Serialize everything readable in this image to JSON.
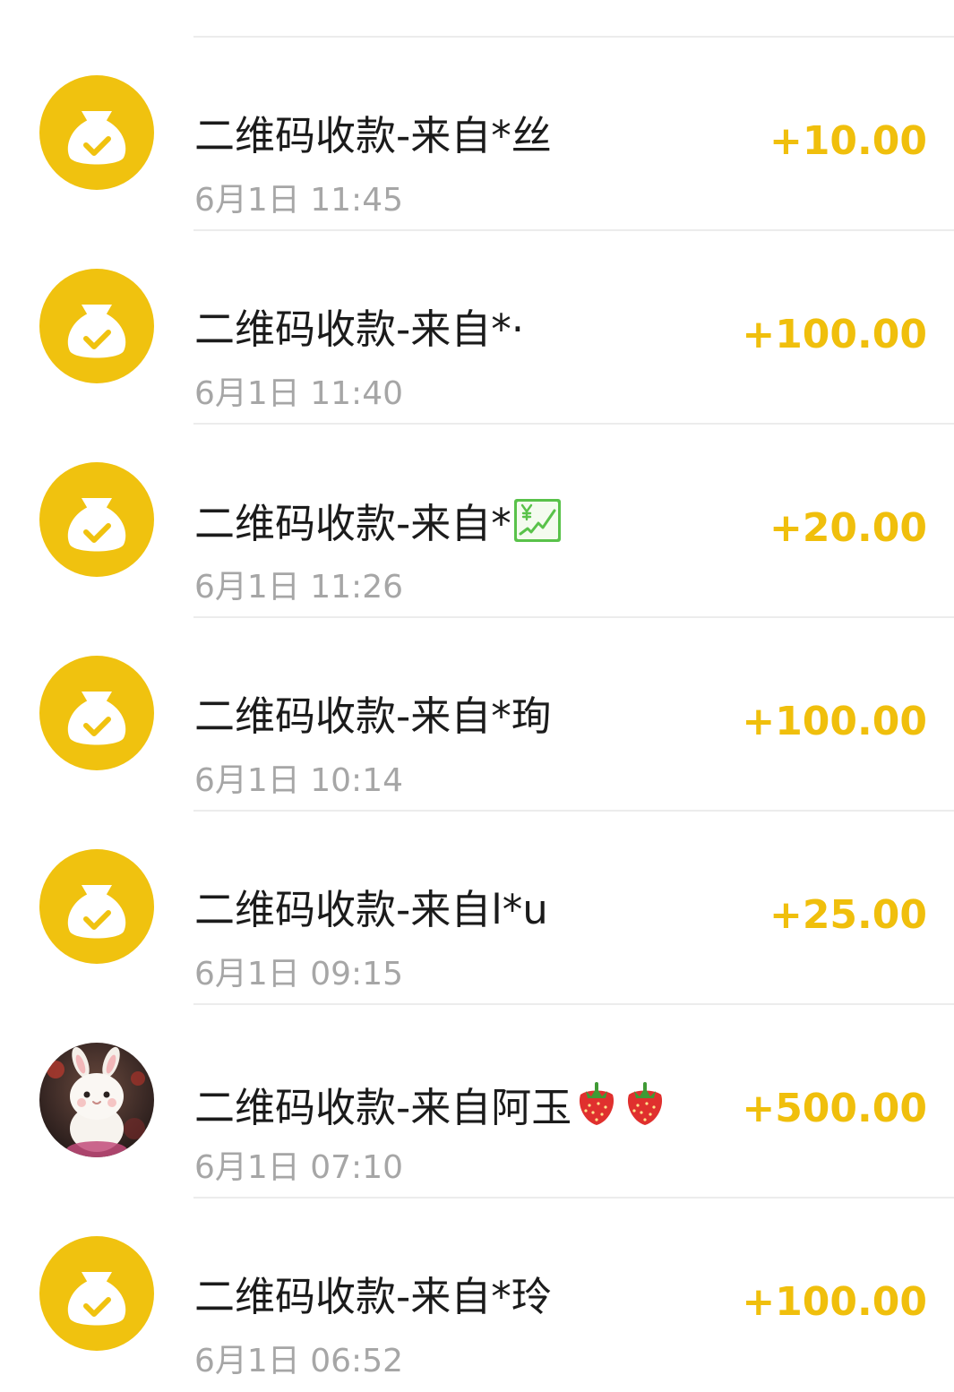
{
  "colors": {
    "accent": "#f0bf0c",
    "coin_background": "#f0c20f",
    "title_text": "#1b1b1b",
    "time_text": "#a6a6a6",
    "divider": "#ececec"
  },
  "transactions": [
    {
      "title": "二维码收款-来自*丝",
      "time": "6月1日 11:45",
      "amount": "+10.00",
      "icon": "money-bag-check-icon"
    },
    {
      "title": "二维码收款-来自*·",
      "time": "6月1日 11:40",
      "amount": "+100.00",
      "icon": "money-bag-check-icon"
    },
    {
      "title": "二维码收款-来自*",
      "title_emoji": "chart-increasing-with-yen-emoji",
      "time": "6月1日 11:26",
      "amount": "+20.00",
      "icon": "money-bag-check-icon"
    },
    {
      "title": "二维码收款-来自*珣",
      "time": "6月1日 10:14",
      "amount": "+100.00",
      "icon": "money-bag-check-icon"
    },
    {
      "title": "二维码收款-来自l*u",
      "time": "6月1日 09:15",
      "amount": "+25.00",
      "icon": "money-bag-check-icon"
    },
    {
      "title": "二维码收款-来自阿玉",
      "title_emoji": "strawberry-emoji",
      "time": "6月1日 07:10",
      "amount": "+500.00",
      "icon": "rabbit-profile-photo"
    },
    {
      "title": "二维码收款-来自*玲",
      "time": "6月1日 06:52",
      "amount": "+100.00",
      "icon": "money-bag-check-icon"
    }
  ]
}
